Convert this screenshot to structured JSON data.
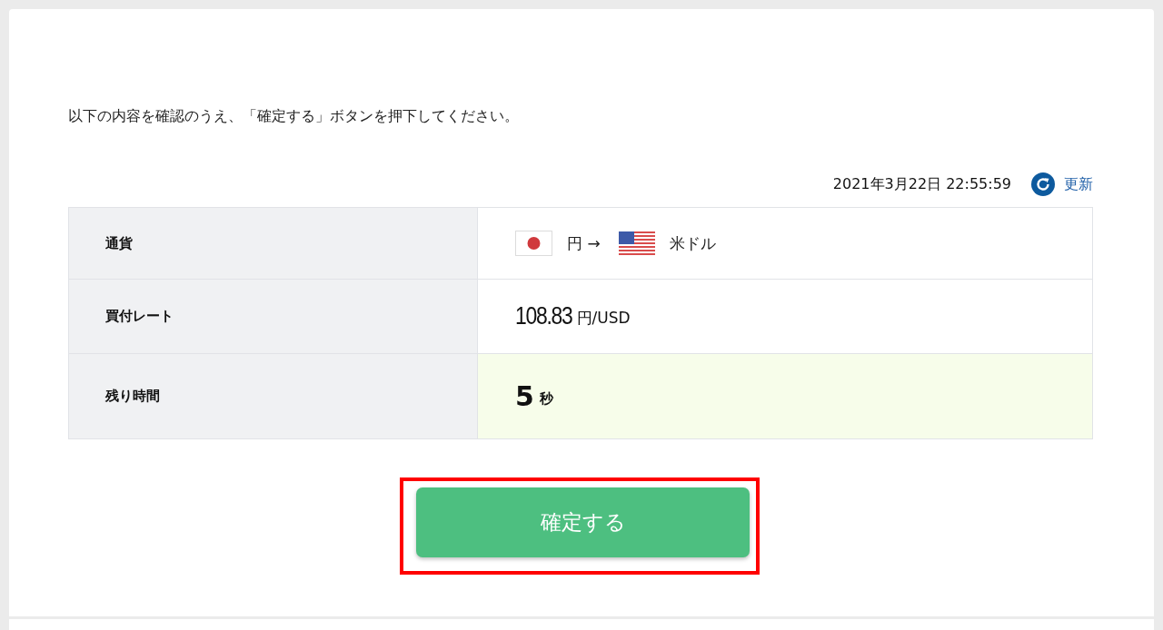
{
  "instruction": "以下の内容を確認のうえ、「確定する」ボタンを押下してください。",
  "timestamp": "2021年3月22日 22:55:59",
  "refresh_link": "更新",
  "table": {
    "rows": [
      {
        "kind": "currency",
        "label": "通貨",
        "highlighted": false,
        "from": "円 →",
        "to": "米ドル"
      },
      {
        "kind": "rate",
        "label": "買付レート",
        "highlighted": false,
        "value": "108.83",
        "unit": "円/USD"
      },
      {
        "kind": "countdown",
        "label": "残り時間",
        "highlighted": true,
        "value": "5",
        "unit": "秒"
      }
    ]
  },
  "confirm_button": {
    "label": "確定する",
    "highlighted": true
  }
}
